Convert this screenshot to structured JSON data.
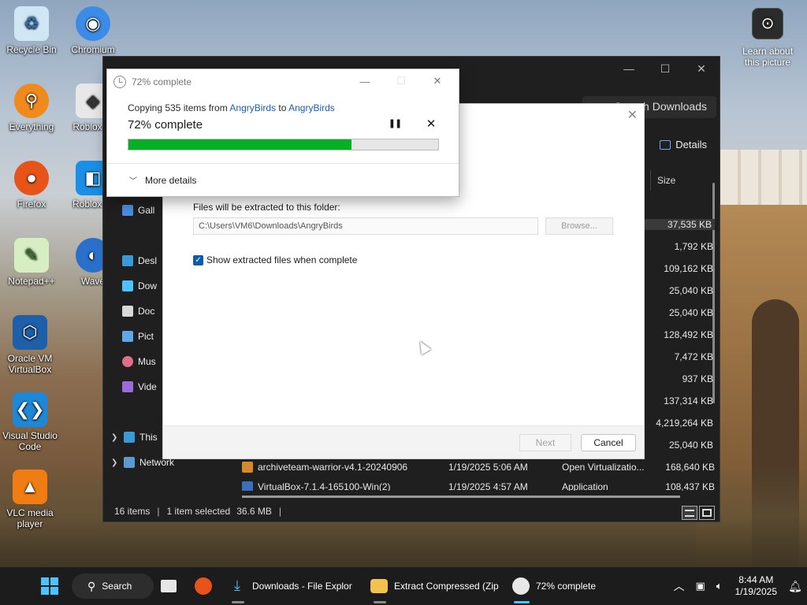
{
  "desktop": {
    "icons": [
      {
        "label": "Recycle Bin",
        "icon": "recycle-bin-icon"
      },
      {
        "label": "Chromium",
        "icon": "chromium-icon"
      },
      {
        "label": "Everything",
        "icon": "everything-search-icon"
      },
      {
        "label": "Roblox Pl",
        "icon": "roblox-player-icon"
      },
      {
        "label": "Firefox",
        "icon": "firefox-icon"
      },
      {
        "label": "Roblox St",
        "icon": "roblox-studio-icon"
      },
      {
        "label": "Notepad++",
        "icon": "notepad-plus-plus-icon"
      },
      {
        "label": "Wave",
        "icon": "wave-icon"
      },
      {
        "label": "Oracle VM VirtualBox",
        "icon": "virtualbox-icon"
      },
      {
        "label": "Visual Studio Code",
        "icon": "vscode-icon"
      },
      {
        "label": "VLC media player",
        "icon": "vlc-icon"
      }
    ],
    "learn_about": "Learn about this picture"
  },
  "explorer": {
    "search_placeholder": "Search Downloads",
    "details_button": "Details",
    "size_header": "Size",
    "nav": [
      {
        "label": "Gall",
        "color": "#4a8fe0"
      },
      {
        "label": "Desl",
        "color": "#3a9ad9"
      },
      {
        "label": "Dow",
        "color": "#4cc2ff"
      },
      {
        "label": "Doc",
        "color": "#d9d9d9"
      },
      {
        "label": "Pict",
        "color": "#5fa8e8"
      },
      {
        "label": "Mus",
        "color": "#e0708a"
      },
      {
        "label": "Vide",
        "color": "#9b6bd8"
      },
      {
        "label": "This",
        "color": "#3a9ad9"
      },
      {
        "label": "Network",
        "color": "#5a9ad0"
      }
    ],
    "sizes": [
      "37,535 KB",
      "1,792 KB",
      "109,162 KB",
      "25,040 KB",
      "25,040 KB",
      "128,492 KB",
      "7,472 KB",
      "937 KB",
      "137,314 KB",
      "4,219,264 KB",
      "25,040 KB"
    ],
    "rows": [
      {
        "name": "archiveteam-warrior-v4.1-20240906",
        "date": "1/19/2025 5:06 AM",
        "type": "Open Virtualizatio...",
        "size": "168,640 KB"
      },
      {
        "name": "VirtualBox-7.1.4-165100-Win(2)",
        "date": "1/19/2025 4:57 AM",
        "type": "Application",
        "size": "108,437 KB"
      }
    ],
    "status": {
      "items": "16 items",
      "selected": "1 item selected",
      "size": "36.6 MB"
    }
  },
  "wizard": {
    "folder_label": "Files will be extracted to this folder:",
    "path_value": "C:\\Users\\VM6\\Downloads\\AngryBirds",
    "browse_label": "Browse...",
    "show_files_label": "Show extracted files when complete",
    "show_files_checked": true,
    "next_label": "Next",
    "cancel_label": "Cancel"
  },
  "progress": {
    "title": "72% complete",
    "copying_prefix": "Copying 535 items from ",
    "source": "AngryBirds",
    "to_word": " to ",
    "destination": "AngryBirds",
    "percent_text": "72% complete",
    "percent_value": 0.72,
    "more_details": "More details",
    "bar_color": "#06b025"
  },
  "taskbar": {
    "search_label": "Search",
    "apps": [
      {
        "label": "Downloads - File Explor",
        "icon": "file-explorer-download-icon"
      },
      {
        "label": "Extract Compressed (Zip",
        "icon": "zip-folder-icon"
      },
      {
        "label": "72% complete",
        "icon": "clock-icon"
      }
    ],
    "time": "8:44 AM",
    "date": "1/19/2025",
    "accent": "#4cc2ff"
  }
}
